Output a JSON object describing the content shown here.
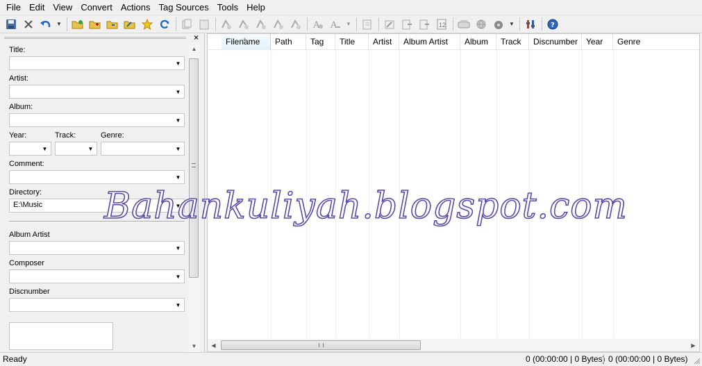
{
  "menubar": {
    "items": [
      "File",
      "Edit",
      "View",
      "Convert",
      "Actions",
      "Tag Sources",
      "Tools",
      "Help"
    ]
  },
  "toolbar": {
    "buttons": [
      {
        "name": "save-icon",
        "glyph": "💾",
        "enabled": true
      },
      {
        "name": "remove-tag-icon",
        "glyph": "✕",
        "enabled": true
      },
      {
        "name": "undo-icon",
        "glyph": "↶",
        "enabled": true
      }
    ]
  },
  "panel": {
    "close_glyph": "×",
    "fields": {
      "title_label": "Title:",
      "title_value": "",
      "artist_label": "Artist:",
      "artist_value": "",
      "album_label": "Album:",
      "album_value": "",
      "year_label": "Year:",
      "year_value": "",
      "track_label": "Track:",
      "track_value": "",
      "genre_label": "Genre:",
      "genre_value": "",
      "comment_label": "Comment:",
      "comment_value": "",
      "directory_label": "Directory:",
      "directory_value": "E:\\Music",
      "album_artist_label": "Album Artist",
      "album_artist_value": "",
      "composer_label": "Composer",
      "composer_value": "",
      "discnumber_label": "Discnumber",
      "discnumber_value": ""
    }
  },
  "file_list": {
    "columns": [
      "Filename",
      "Path",
      "Tag",
      "Title",
      "Artist",
      "Album Artist",
      "Album",
      "Track",
      "Discnumber",
      "Year",
      "Genre"
    ],
    "sorted_column": "Filename",
    "rows": []
  },
  "statusbar": {
    "status": "Ready",
    "selected": "0 (00:00:00 | 0 Bytes)",
    "total": "0 (00:00:00 | 0 Bytes)"
  },
  "watermark": {
    "text": "Bahankuliyah.blogspot.com",
    "color": "#5b4ba8"
  }
}
